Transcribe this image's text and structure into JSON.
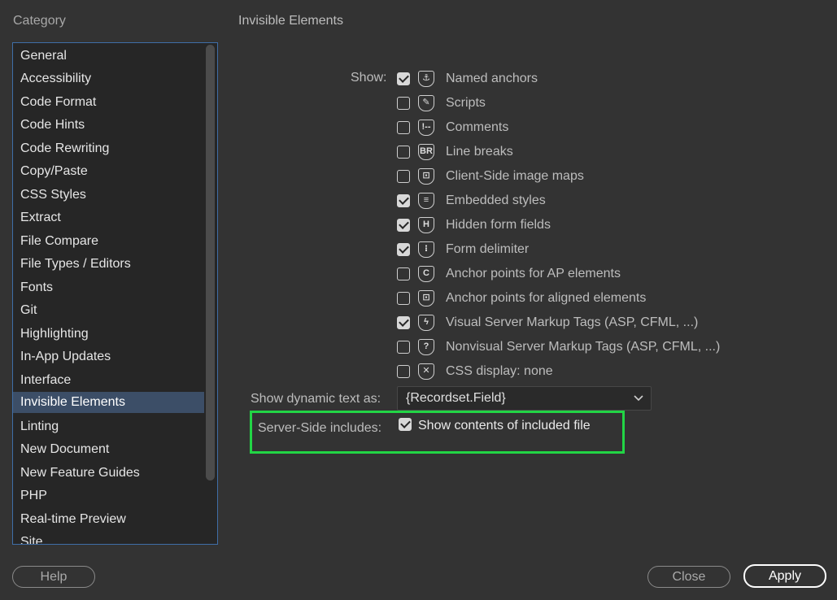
{
  "category": {
    "label": "Category",
    "items": [
      "General",
      "Accessibility",
      "Code Format",
      "Code Hints",
      "Code Rewriting",
      "Copy/Paste",
      "CSS Styles",
      "Extract",
      "File Compare",
      "File Types / Editors",
      "Fonts",
      "Git",
      "Highlighting",
      "In-App Updates",
      "Interface",
      "Invisible Elements",
      "Linting",
      "New Document",
      "New Feature Guides",
      "PHP",
      "Real-time Preview",
      "Site"
    ],
    "selected": "Invisible Elements"
  },
  "panel": {
    "title": "Invisible Elements",
    "show_label": "Show:",
    "options": [
      {
        "label": "Named anchors",
        "checked": true,
        "icon": "anchor-icon"
      },
      {
        "label": "Scripts",
        "checked": false,
        "icon": "script-icon"
      },
      {
        "label": "Comments",
        "checked": false,
        "icon": "comment-icon"
      },
      {
        "label": "Line breaks",
        "checked": false,
        "icon": "line-break-icon"
      },
      {
        "label": "Client-Side image maps",
        "checked": false,
        "icon": "image-map-icon"
      },
      {
        "label": "Embedded styles",
        "checked": true,
        "icon": "embedded-style-icon"
      },
      {
        "label": "Hidden form fields",
        "checked": true,
        "icon": "hidden-field-icon"
      },
      {
        "label": "Form delimiter",
        "checked": true,
        "icon": "form-delimiter-icon"
      },
      {
        "label": "Anchor points for AP elements",
        "checked": false,
        "icon": "ap-anchor-icon"
      },
      {
        "label": "Anchor points for aligned elements",
        "checked": false,
        "icon": "aligned-anchor-icon"
      },
      {
        "label": "Visual Server Markup Tags (ASP, CFML, ...)",
        "checked": true,
        "icon": "visual-server-tag-icon"
      },
      {
        "label": "Nonvisual Server Markup Tags (ASP, CFML, ...)",
        "checked": false,
        "icon": "nonvisual-server-tag-icon"
      },
      {
        "label": "CSS display: none",
        "checked": false,
        "icon": "css-display-none-icon"
      }
    ],
    "dynamic_text_label": "Show dynamic text as:",
    "dynamic_text_value": "{Recordset.Field}",
    "ssi_label": "Server-Side includes:",
    "ssi_option_label": "Show contents of included file",
    "ssi_checked": true,
    "highlight_color": "#22d545"
  },
  "buttons": {
    "help": "Help",
    "close": "Close",
    "apply": "Apply"
  }
}
